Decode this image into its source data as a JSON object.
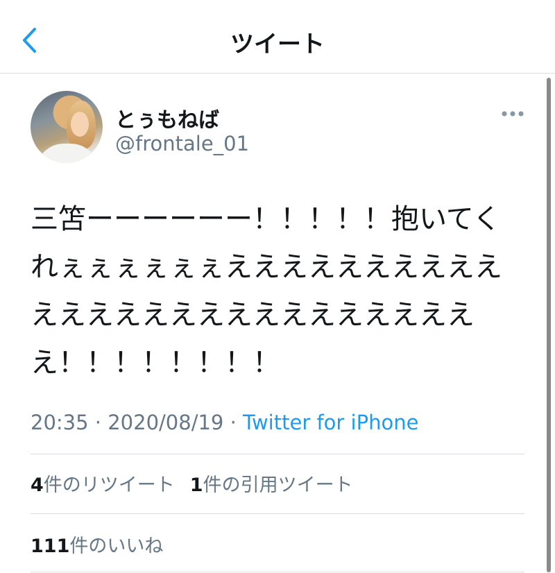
{
  "header": {
    "title": "ツイート"
  },
  "tweet": {
    "display_name": "とぅもねば",
    "handle": "@frontale_01",
    "text": "三笘ーーーーーー！！！！！抱いてくれぇぇぇぇぇぇえええええええええええええええええええええええええええ！！！！！！！！",
    "time": "20:35",
    "separator": " · ",
    "date": "2020/08/19",
    "source": "Twitter for iPhone",
    "retweets": {
      "count": "4",
      "label": "件のリツイート"
    },
    "quotes": {
      "count": "1",
      "label": "件の引用ツイート"
    },
    "likes": {
      "count": "111",
      "label": "件のいいね"
    }
  },
  "icons": {
    "back": "chevron-left-icon",
    "more": "more-horizontal-icon"
  },
  "colors": {
    "accent": "#1d9bf0",
    "secondary_text": "#657786",
    "primary_text": "#14171a",
    "divider": "#d9dde1"
  }
}
